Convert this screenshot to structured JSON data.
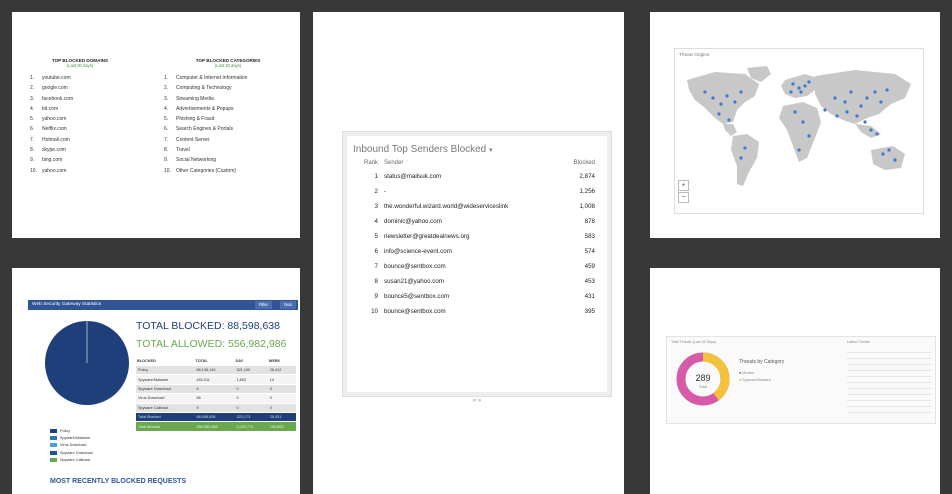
{
  "panel_top_blocked": {
    "domains": {
      "title": "TOP BLOCKED DOMAINS",
      "subtitle": "(Last 30 days)",
      "items": [
        "youtube.com",
        "google.com",
        "facebook.com",
        "bit.com",
        "yahoo.com",
        "Netflix.com",
        "Hotmail.com",
        "skype.com",
        "bing.com",
        "yahoo.com"
      ]
    },
    "categories": {
      "title": "TOP BLOCKED CATEGORIES",
      "subtitle": "(Last 30 days)",
      "items": [
        "Computer & Internet Information",
        "Computing & Technology",
        "Streaming Media",
        "Advertisements & Popups",
        "Phishing & Fraud",
        "Search Engines & Portals",
        "Content Server",
        "Travel",
        "Social Networking",
        "Other Categories (Custom)"
      ]
    }
  },
  "panel_senders": {
    "title": "Inbound Top Senders Blocked",
    "caret": "▾",
    "columns": [
      "Rank",
      "Sender",
      "Blocked"
    ],
    "rows": [
      {
        "rank": "1",
        "sender": "status@mailsuk.com",
        "blocked": "2,874"
      },
      {
        "rank": "2",
        "sender": "-",
        "blocked": "1,256"
      },
      {
        "rank": "3",
        "sender": "the.wonderful.wizard.world@wideserviceslink",
        "blocked": "1,008"
      },
      {
        "rank": "4",
        "sender": "dominic@yahoo.com",
        "blocked": "878"
      },
      {
        "rank": "5",
        "sender": "newsletter@greatdealnews.org",
        "blocked": "583"
      },
      {
        "rank": "6",
        "sender": "info@science-event.com",
        "blocked": "574"
      },
      {
        "rank": "7",
        "sender": "bounce@sentbox.com",
        "blocked": "459"
      },
      {
        "rank": "8",
        "sender": "susan21@yahoo.com",
        "blocked": "453"
      },
      {
        "rank": "9",
        "sender": "bounce5@sentbox.com",
        "blocked": "431"
      },
      {
        "rank": "10",
        "sender": "bounce@sentbox.com",
        "blocked": "395"
      }
    ],
    "pager": "« »"
  },
  "panel_map": {
    "title": "Threat Origins",
    "zoom_in": "+",
    "zoom_out": "−",
    "land_color": "#c8c8c8",
    "dot_color": "#3d7ad6"
  },
  "panel_swg": {
    "header": "Web Security Gateway Statistics",
    "header_btn1": "Filter",
    "header_btn2": "Year",
    "total_blocked": "TOTAL BLOCKED: 88,598,638",
    "total_allowed": "TOTAL ALLOWED: 556,982,986",
    "table_headers": [
      "BLOCKED",
      "TOTAL",
      "DAY",
      "WEEK"
    ],
    "table_rows": [
      {
        "label": "Policy",
        "c1": "88,136,143",
        "c2": "321,100",
        "c3": "26,412"
      },
      {
        "label": "Spyware/Malware",
        "c1": "453,011",
        "c2": "1,893",
        "c3": "14"
      },
      {
        "label": "Spyware Download",
        "c1": "6",
        "c2": "0",
        "c3": "0"
      },
      {
        "label": "Virus Download",
        "c1": "86",
        "c2": "0",
        "c3": "0"
      },
      {
        "label": "Spyware Callback",
        "c1": "9",
        "c2": "0",
        "c3": "0"
      },
      {
        "label": "Total Blocked",
        "c1": "88,598,638",
        "c2": "323,173",
        "c3": "26,431"
      },
      {
        "label": "Total Allowed",
        "c1": "556,982,986",
        "c2": "2,022,771",
        "c3": "190,863"
      }
    ],
    "legend": [
      "Policy",
      "Spyware/Malware",
      "Virus Download",
      "Spyware Download",
      "Spyware Callback"
    ],
    "legend_colors": [
      "#1e3f7a",
      "#2e75b6",
      "#4aa0d8",
      "#1f4e9a",
      "#6aa84f"
    ],
    "recent_title": "MOST RECENTLY BLOCKED REQUESTS",
    "pie_color": "#1e3f7a"
  },
  "panel_threat": {
    "header_left": "Total Threats (Last 30 Days)",
    "header_right": "Latest Threats",
    "donut_value": "289",
    "donut_label": "Total",
    "summary_title": "Threats by Category",
    "legend": [
      "Viruses",
      "Spyware/Malware"
    ],
    "colors": [
      "#d65aa8",
      "#f3c13a",
      "#ffffff"
    ]
  }
}
